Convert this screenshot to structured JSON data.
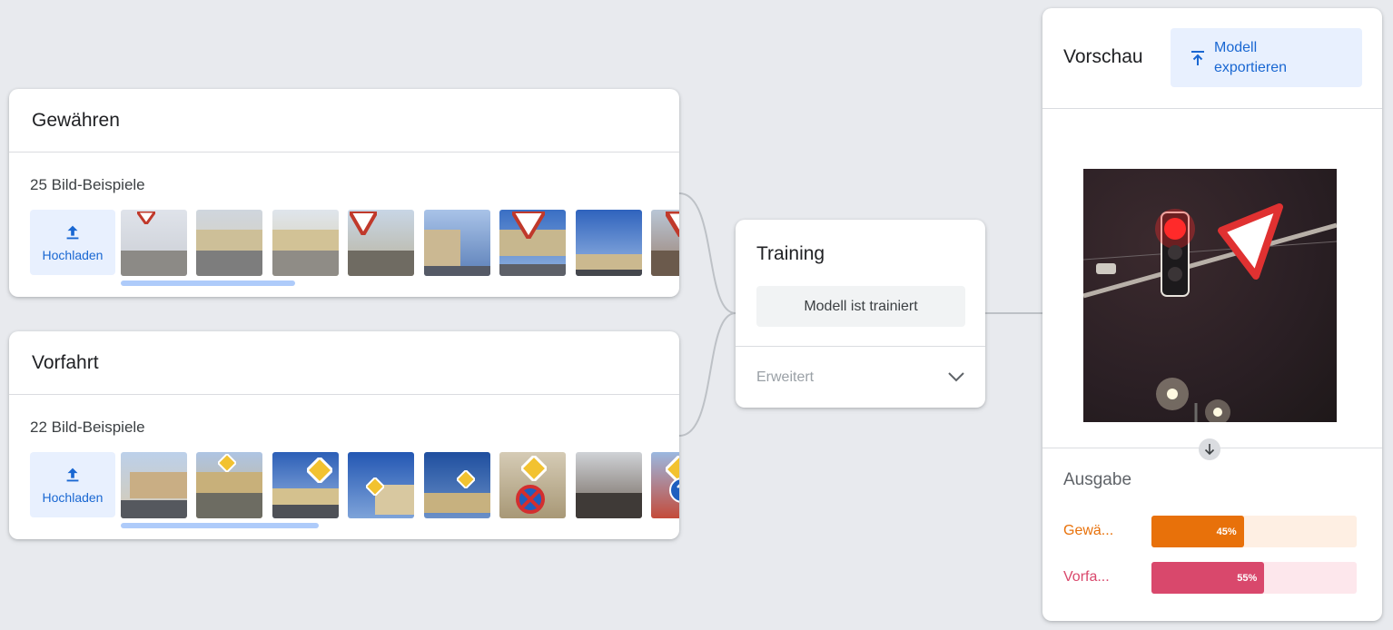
{
  "classes": [
    {
      "name": "Gewähren",
      "count_text": "25 Bild-Beispiele",
      "upload_label": "Hochladen"
    },
    {
      "name": "Vorfahrt",
      "count_text": "22 Bild-Beispiele",
      "upload_label": "Hochladen"
    }
  ],
  "training": {
    "title": "Training",
    "status_button": "Modell ist trainiert",
    "advanced_label": "Erweitert",
    "advanced_icon": "chevron-down-icon"
  },
  "preview": {
    "title": "Vorschau",
    "export_label_line1": "Modell",
    "export_label_line2": "exportieren",
    "export_icon": "export-upload-icon",
    "output_title": "Ausgabe",
    "results": [
      {
        "label": "Gewä...",
        "percent": 45,
        "percent_text": "45%",
        "color": "#e8710a",
        "track_color": "#feefe3"
      },
      {
        "label": "Vorfa...",
        "percent": 55,
        "percent_text": "55%",
        "color": "#d9486c",
        "track_color": "#fde7ec"
      }
    ]
  },
  "colors": {
    "accent_blue": "#1967d2",
    "accent_blue_bg": "#e8f0fe",
    "background": "#e8eaee",
    "scrollbar": "#aecbfa"
  }
}
